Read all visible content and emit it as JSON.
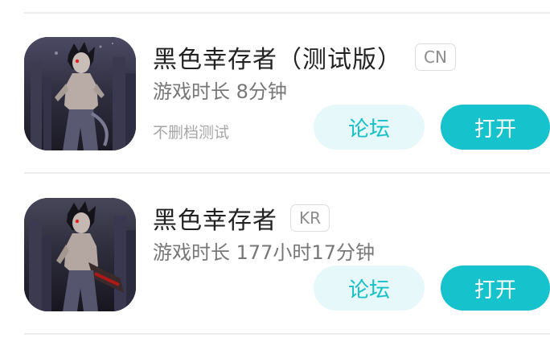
{
  "games": [
    {
      "title": "黑色幸存者（测试版）",
      "region": "CN",
      "playtime": "游戏时长 8分钟",
      "note": "不删档测试",
      "forum_label": "论坛",
      "open_label": "打开"
    },
    {
      "title": "黑色幸存者",
      "region": "KR",
      "playtime": "游戏时长 177小时17分钟",
      "note": "",
      "forum_label": "论坛",
      "open_label": "打开"
    }
  ],
  "colors": {
    "accent": "#16c2cb",
    "accent_light": "#e6f8fa",
    "title_text": "#222222",
    "sub_text": "#777777"
  },
  "icons": [
    "game-cover-icon"
  ]
}
